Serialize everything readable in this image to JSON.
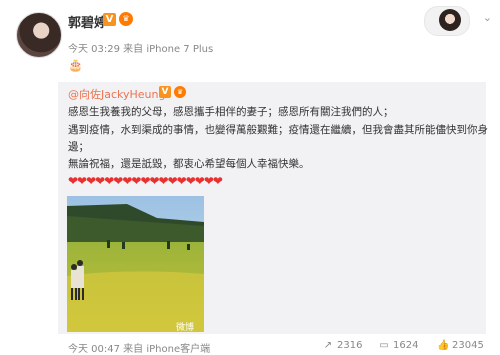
{
  "post": {
    "author": "郭碧婷",
    "verified_badge": "V",
    "meta": "今天 03:29 来自 iPhone 7 Plus",
    "emoji": "🎂"
  },
  "repost": {
    "author": "@向佐JackyHeung",
    "verified_badge": "V",
    "lines": [
      "感恩生我養我的父母，感恩攜手相伴的妻子；感恩所有關注我們的人；",
      "遇到疫情，水到渠成的事情，也變得萬般艱難；疫情還在繼續，但我會盡其所能儘快到你身",
      "邊；",
      "無論祝福，還是詆毀，都衷心希望每個人幸福快樂。"
    ],
    "hearts": "❤❤❤❤❤❤❤❤❤❤❤❤❤❤❤❤❤",
    "image_watermark": "微博",
    "footer_meta": "今天 00:47 来自 iPhone客户端",
    "actions": {
      "repost_count": "2316",
      "comment_count": "1624",
      "like_count": "23045"
    }
  },
  "colors": {
    "accent": "#eb7350",
    "heart": "#e8312f",
    "repost_bg": "#f2f2f5"
  },
  "icons": [
    "share-icon",
    "comment-icon",
    "like-icon",
    "chevron-down-icon",
    "cake-icon"
  ]
}
